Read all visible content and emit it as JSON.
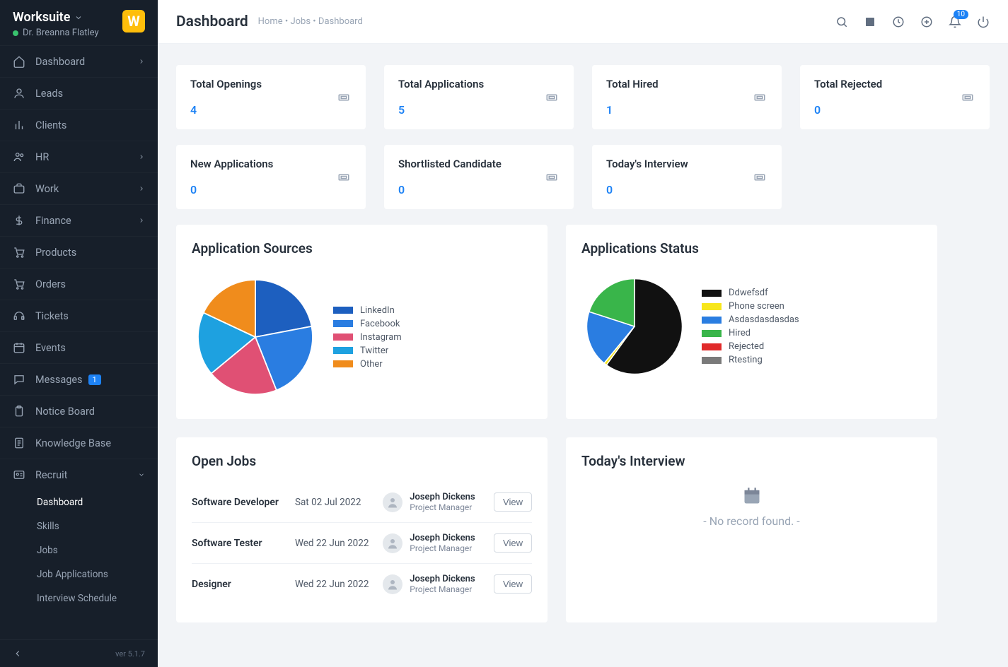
{
  "brand": {
    "name": "Worksuite",
    "initial": "W"
  },
  "user": {
    "name": "Dr. Breanna Flatley"
  },
  "sidebar": {
    "items": [
      {
        "label": "Dashboard",
        "icon": "home",
        "chevron": true
      },
      {
        "label": "Leads",
        "icon": "user"
      },
      {
        "label": "Clients",
        "icon": "bar"
      },
      {
        "label": "HR",
        "icon": "people",
        "chevron": true
      },
      {
        "label": "Work",
        "icon": "briefcase",
        "chevron": true
      },
      {
        "label": "Finance",
        "icon": "dollar",
        "chevron": true
      },
      {
        "label": "Products",
        "icon": "cart"
      },
      {
        "label": "Orders",
        "icon": "cart"
      },
      {
        "label": "Tickets",
        "icon": "headset"
      },
      {
        "label": "Events",
        "icon": "calendar"
      },
      {
        "label": "Messages",
        "icon": "message",
        "badge": "1"
      },
      {
        "label": "Notice Board",
        "icon": "clipboard"
      },
      {
        "label": "Knowledge Base",
        "icon": "doc"
      },
      {
        "label": "Recruit",
        "icon": "id",
        "expanded": true,
        "children": [
          {
            "label": "Dashboard",
            "active": true
          },
          {
            "label": "Skills"
          },
          {
            "label": "Jobs"
          },
          {
            "label": "Job Applications"
          },
          {
            "label": "Interview Schedule"
          }
        ]
      }
    ],
    "version": "ver 5.1.7"
  },
  "header": {
    "title": "Dashboard",
    "breadcrumb": [
      "Home",
      "Jobs",
      "Dashboard"
    ],
    "notification_count": "10"
  },
  "stats_row1": [
    {
      "label": "Total Openings",
      "value": "4"
    },
    {
      "label": "Total Applications",
      "value": "5"
    },
    {
      "label": "Total Hired",
      "value": "1"
    },
    {
      "label": "Total Rejected",
      "value": "0"
    }
  ],
  "stats_row2": [
    {
      "label": "New Applications",
      "value": "0"
    },
    {
      "label": "Shortlisted Candidate",
      "value": "0"
    },
    {
      "label": "Today's Interview",
      "value": "0"
    }
  ],
  "panels": {
    "sources_title": "Application Sources",
    "status_title": "Applications Status",
    "open_jobs_title": "Open Jobs",
    "interview_title": "Today's Interview",
    "no_record": "- No record found. -",
    "view_label": "View"
  },
  "open_jobs": [
    {
      "title": "Software Developer",
      "date": "Sat 02 Jul 2022",
      "person": "Joseph Dickens",
      "role": "Project Manager"
    },
    {
      "title": "Software Tester",
      "date": "Wed 22 Jun 2022",
      "person": "Joseph Dickens",
      "role": "Project Manager"
    },
    {
      "title": "Designer",
      "date": "Wed 22 Jun 2022",
      "person": "Joseph Dickens",
      "role": "Project Manager"
    }
  ],
  "chart_data": [
    {
      "type": "pie",
      "title": "Application Sources",
      "series": [
        {
          "name": "LinkedIn",
          "value": 22,
          "color": "#1d5fbf"
        },
        {
          "name": "Facebook",
          "value": 22,
          "color": "#2a7de1"
        },
        {
          "name": "Instagram",
          "value": 20,
          "color": "#e05074"
        },
        {
          "name": "Twitter",
          "value": 18,
          "color": "#1ea1e0"
        },
        {
          "name": "Other",
          "value": 18,
          "color": "#f08c1c"
        }
      ]
    },
    {
      "type": "pie",
      "title": "Applications Status",
      "series": [
        {
          "name": "Ddwefsdf",
          "value": 60,
          "color": "#111111"
        },
        {
          "name": "Phone screen",
          "value": 1,
          "color": "#f7e61b"
        },
        {
          "name": "Asdasdasdasdas",
          "value": 19,
          "color": "#2a7de1"
        },
        {
          "name": "Hired",
          "value": 20,
          "color": "#39b54a"
        },
        {
          "name": "Rejected",
          "value": 0,
          "color": "#e02a2a"
        },
        {
          "name": "Rtesting",
          "value": 0,
          "color": "#7a7a7a"
        }
      ]
    }
  ]
}
